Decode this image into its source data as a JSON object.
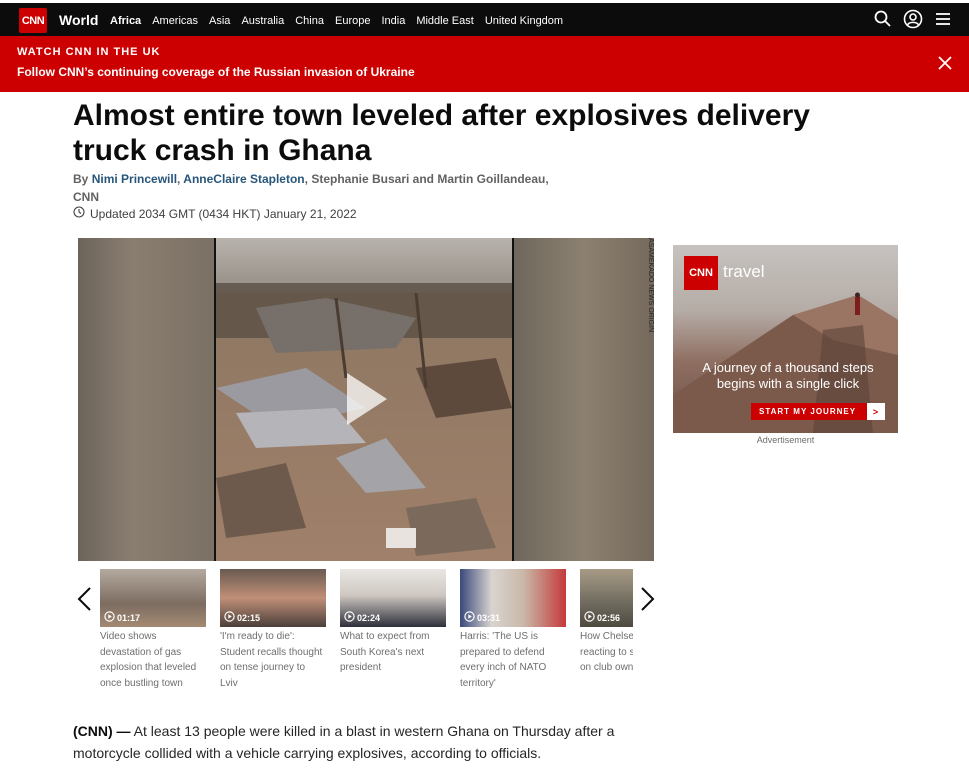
{
  "header": {
    "logo": "CNN",
    "section": "World",
    "nav": [
      "Africa",
      "Americas",
      "Asia",
      "Australia",
      "China",
      "Europe",
      "India",
      "Middle East",
      "United Kingdom"
    ],
    "active_nav": "Africa",
    "icons": [
      "search-icon",
      "account-icon",
      "menu-icon"
    ]
  },
  "banner": {
    "kicker": "WATCH CNN IN THE UK",
    "text": "Follow CNN’s continuing coverage of the Russian invasion of Ukraine",
    "close_icon": "close-icon",
    "color": "#cc0000"
  },
  "article": {
    "headline": "Almost entire town leveled after explosives delivery truck crash in Ghana",
    "byline_prefix": "By",
    "authors_linked": [
      "Nimi Princewill",
      "AnneClaire Stapleton"
    ],
    "authors_plain": "Stephanie Busari and Martin Goillandeau,",
    "byline_source": "CNN",
    "updated": "Updated 2034 GMT (0434 HKT) January 21, 2022",
    "body_tag": "(CNN) —",
    "body": "At least 13 people were killed in a blast in western Ghana on Thursday after a motorcycle collided with a vehicle carrying explosives, according to officials."
  },
  "video": {
    "watermark": "ASAMEKADO NEWS ORIGIN",
    "play_icon": "play-icon"
  },
  "playlist": [
    {
      "duration": "01:17",
      "caption": "Video shows devastation of gas explosion that leveled once bustling town"
    },
    {
      "duration": "02:15",
      "caption": "'I'm ready to die': Student recalls thought on tense journey to Lviv"
    },
    {
      "duration": "02:24",
      "caption": "What to expect from South Korea's next president"
    },
    {
      "duration": "03:31",
      "caption": "Harris: 'The US is prepared to defend every inch of NATO territory'"
    },
    {
      "duration": "02:56",
      "caption": "How Chelsea fans are reacting to sanctions on club owner"
    }
  ],
  "ad": {
    "logo": "CNN",
    "brand": "travel",
    "text": "A journey of a thousand steps begins with a single click",
    "button": "START MY JOURNEY",
    "button_arrow": ">",
    "label": "Advertisement"
  }
}
